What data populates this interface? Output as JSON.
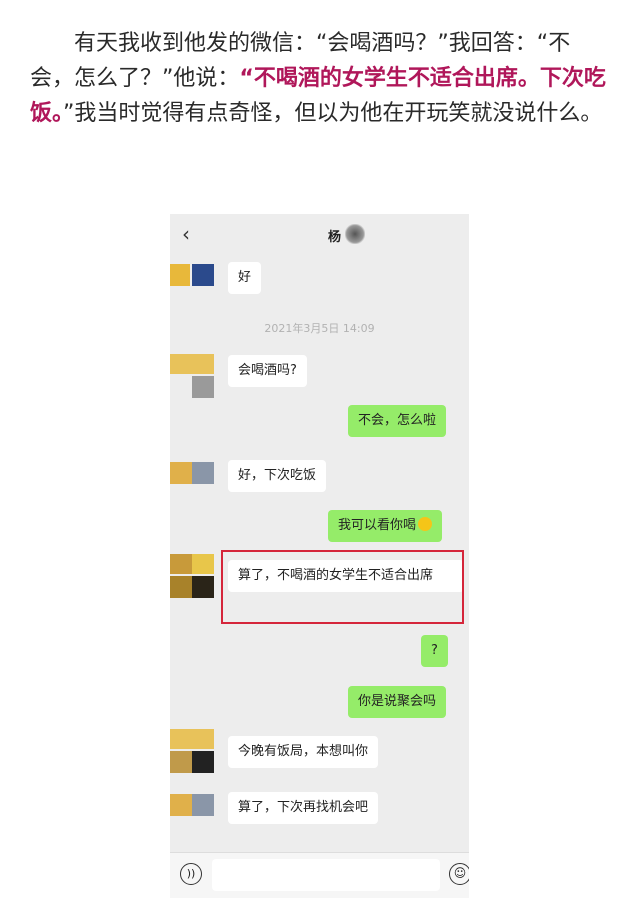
{
  "article": {
    "part1": "有天我收到他发的微信：“会喝酒吗？”我回答：“不会，怎么了？”他说：",
    "highlight": "“不喝酒的女学生不适合出席。下次吃饭。",
    "part2": "”我当时觉得有点奇怪，但以为他在开玩笑就没说什么。"
  },
  "chat": {
    "back_icon": "chevron-left-icon",
    "contact_name": "杨",
    "timestamp": "2021年3月5日 14:09",
    "messages": [
      {
        "side": "in",
        "text": "好"
      },
      {
        "side": "in",
        "text": "会喝酒吗?"
      },
      {
        "side": "out",
        "text": "不会，怎么啦"
      },
      {
        "side": "in",
        "text": "好，下次吃饭"
      },
      {
        "side": "out",
        "text": "我可以看你喝"
      },
      {
        "side": "in",
        "text": "算了，不喝酒的女学生不适合出席"
      },
      {
        "side": "out",
        "text": "?"
      },
      {
        "side": "out",
        "text": "你是说聚会吗"
      },
      {
        "side": "in",
        "text": "今晚有饭局，本想叫你"
      },
      {
        "side": "in",
        "text": "算了，下次再找机会吧"
      }
    ],
    "voice_icon": "voice-icon",
    "emoji_icon": "emoji-icon"
  },
  "colors": {
    "highlight": "#b0175a",
    "bubble_out": "#95ec69",
    "redbox": "#d5263b"
  }
}
